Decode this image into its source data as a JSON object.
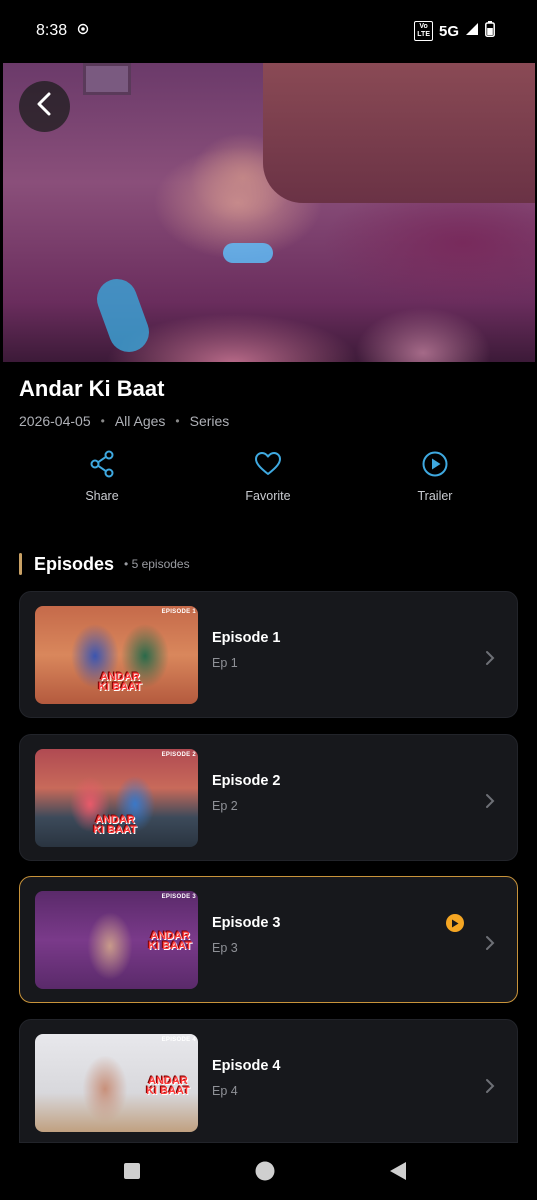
{
  "status_bar": {
    "time": "8:38",
    "network": "5G",
    "volte": "Vo LTE"
  },
  "hero": {
    "back_icon": "chevron-left-icon"
  },
  "show": {
    "title": "Andar Ki Baat",
    "date": "2026-04-05",
    "rating": "All Ages",
    "type": "Series"
  },
  "actions": [
    {
      "label": "Share",
      "icon": "share-icon"
    },
    {
      "label": "Favorite",
      "icon": "heart-icon"
    },
    {
      "label": "Trailer",
      "icon": "play-circle-icon"
    }
  ],
  "episodes_section": {
    "title": "Episodes",
    "count": "• 5 episodes"
  },
  "episodes": [
    {
      "title": "Episode 1",
      "sub": "Ep 1",
      "tag": "EPISODE 1",
      "logo": "ANDAR KI BAAT",
      "playing": false
    },
    {
      "title": "Episode 2",
      "sub": "Ep 2",
      "tag": "EPISODE 2",
      "logo": "ANDAR KI BAAT",
      "playing": false
    },
    {
      "title": "Episode 3",
      "sub": "Ep 3",
      "tag": "EPISODE 3",
      "logo": "ANDAR KI BAAT",
      "playing": true
    },
    {
      "title": "Episode 4",
      "sub": "Ep 4",
      "tag": "EPISODE 4",
      "logo": "ANDAR KI BAAT",
      "playing": false
    }
  ],
  "colors": {
    "accent": "#c8933a",
    "action_icon": "#3fa9e0",
    "playing": "#f5a623",
    "card_bg": "#17181c"
  }
}
